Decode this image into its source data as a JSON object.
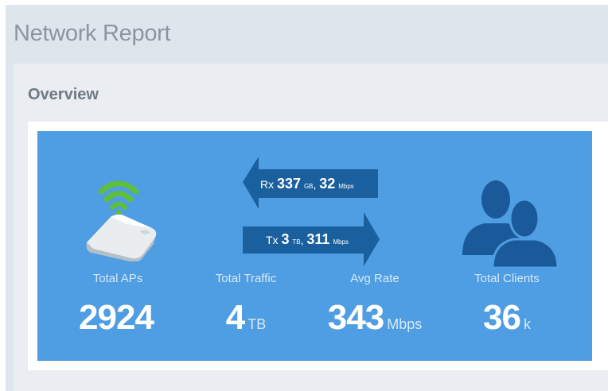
{
  "header": {
    "title": "Network Report"
  },
  "overview": {
    "title": "Overview",
    "traffic_flow": {
      "rx": {
        "prefix": "Rx",
        "volume": "337",
        "volume_unit": "GB",
        "sep": ",",
        "rate": "32",
        "rate_unit": "Mbps"
      },
      "tx": {
        "prefix": "Tx",
        "volume": "3",
        "volume_unit": "TB",
        "sep": ",",
        "rate": "311",
        "rate_unit": "Mbps"
      }
    },
    "stats": {
      "total_aps": {
        "label": "Total APs",
        "value": "2924",
        "unit": ""
      },
      "total_traffic": {
        "label": "Total Traffic",
        "value": "4",
        "unit": "TB"
      },
      "avg_rate": {
        "label": "Avg Rate",
        "value": "343",
        "unit": "Mbps"
      },
      "total_clients": {
        "label": "Total Clients",
        "value": "36",
        "unit": "k"
      }
    },
    "icons": {
      "access_point": "access-point-icon",
      "wifi": "wifi-signal-icon",
      "clients": "users-icon"
    },
    "colors": {
      "card_bg": "#4f9de2",
      "arrow": "#1a5f9e",
      "wifi": "#5fbf3c",
      "clients_icon": "#1a5a9a"
    }
  }
}
